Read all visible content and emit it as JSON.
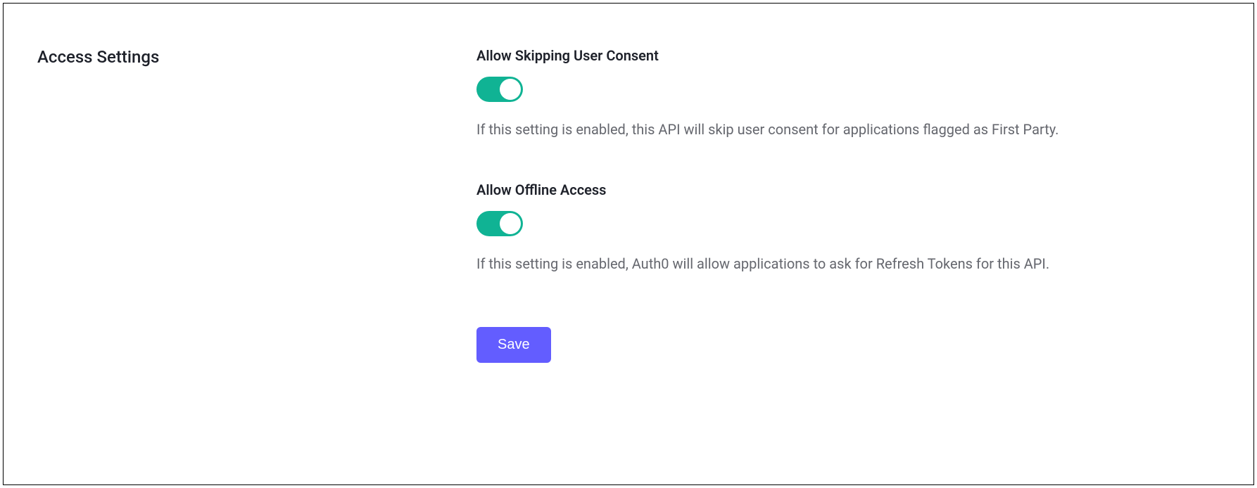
{
  "section": {
    "title": "Access Settings"
  },
  "settings": {
    "skip_consent": {
      "label": "Allow Skipping User Consent",
      "enabled": true,
      "description": "If this setting is enabled, this API will skip user consent for applications flagged as First Party."
    },
    "offline_access": {
      "label": "Allow Offline Access",
      "enabled": true,
      "description": "If this setting is enabled, Auth0 will allow applications to ask for Refresh Tokens for this API."
    }
  },
  "actions": {
    "save_label": "Save"
  },
  "colors": {
    "toggle_on": "#10b394",
    "primary_button": "#635dff"
  }
}
